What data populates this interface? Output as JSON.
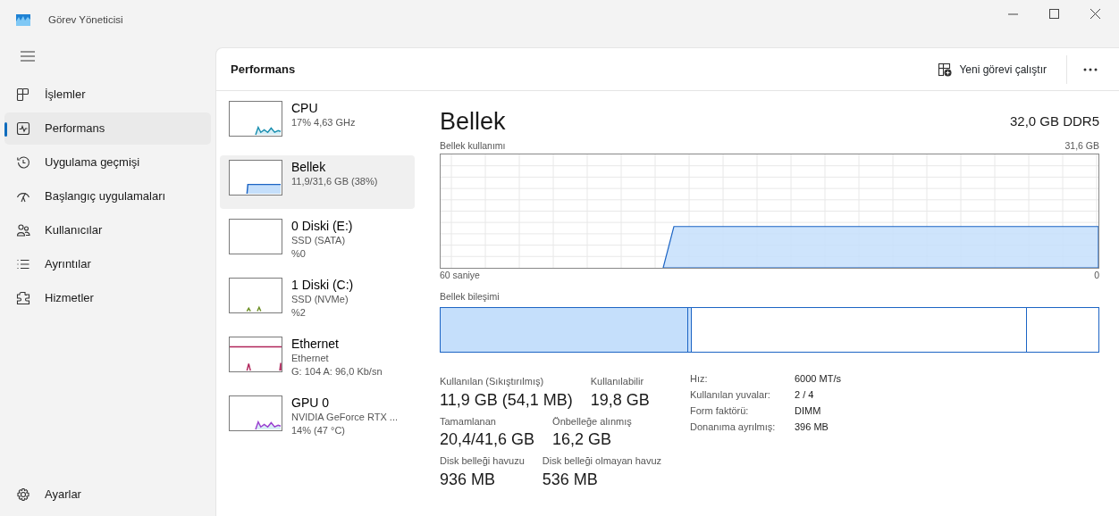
{
  "window": {
    "title": "Görev Yöneticisi"
  },
  "nav": {
    "items": [
      {
        "label": "İşlemler",
        "selected": false
      },
      {
        "label": "Performans",
        "selected": true
      },
      {
        "label": "Uygulama geçmişi",
        "selected": false
      },
      {
        "label": "Başlangıç uygulamaları",
        "selected": false
      },
      {
        "label": "Kullanıcılar",
        "selected": false
      },
      {
        "label": "Ayrıntılar",
        "selected": false
      },
      {
        "label": "Hizmetler",
        "selected": false
      }
    ],
    "settings": {
      "label": "Ayarlar",
      "selected": false
    }
  },
  "header": {
    "title": "Performans",
    "run_task": "Yeni görevi çalıştır"
  },
  "devices": [
    {
      "name": "CPU",
      "lines": [
        "17% 4,63 GHz"
      ],
      "kind": "spiky",
      "color": "#1a8fb0",
      "selected": false
    },
    {
      "name": "Bellek",
      "lines": [
        "11,9/31,6 GB (38%)"
      ],
      "kind": "step",
      "color": "#1c64c4",
      "selected": true
    },
    {
      "name": "0 Diski (E:)",
      "lines": [
        "SSD (SATA)",
        "%0"
      ],
      "kind": "empty",
      "selected": false
    },
    {
      "name": "1 Diski (C:)",
      "lines": [
        "SSD (NVMe)",
        "%2"
      ],
      "kind": "blips",
      "color": "#6b8e23",
      "selected": false
    },
    {
      "name": "Ethernet",
      "lines": [
        "Ethernet",
        "G: 104 A: 96,0 Kb/sn"
      ],
      "kind": "network",
      "color": "#b0245a",
      "selected": false
    },
    {
      "name": "GPU 0",
      "lines": [
        "NVIDIA GeForce RTX ...",
        "14% (47 °C)"
      ],
      "kind": "spiky",
      "color": "#9a3fd0",
      "selected": false
    }
  ],
  "detail": {
    "title": "Bellek",
    "spec": "32,0 GB DDR5",
    "usage": {
      "label": "Bellek kullanımı",
      "max": "31,6 GB",
      "start": "60 saniye",
      "end": "0"
    },
    "composition": {
      "label": "Bellek bileşimi"
    },
    "stats": [
      [
        {
          "label": "Kullanılan (Sıkıştırılmış)",
          "value": "11,9 GB (54,1 MB)"
        },
        {
          "label": "Kullanılabilir",
          "value": "19,8 GB"
        }
      ],
      [
        {
          "label": "Tamamlanan",
          "value": "20,4/41,6 GB"
        },
        {
          "label": "Önbelleğe alınmış",
          "value": "16,2 GB"
        }
      ],
      [
        {
          "label": "Disk belleği havuzu",
          "value": "936 MB"
        },
        {
          "label": "Disk belleği olmayan havuz",
          "value": "536 MB"
        }
      ]
    ],
    "properties": [
      {
        "label": "Hız:",
        "value": "6000 MT/s"
      },
      {
        "label": "Kullanılan yuvalar:",
        "value": "2 / 4"
      },
      {
        "label": "Form faktörü:",
        "value": "DIMM"
      },
      {
        "label": "Donanıma ayrılmış:",
        "value": "396 MB"
      }
    ]
  }
}
